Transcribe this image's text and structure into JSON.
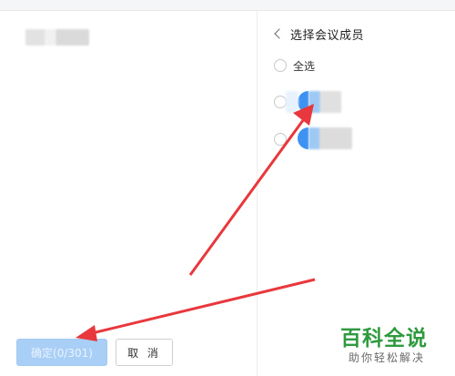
{
  "panel": {
    "title": "选择会议成员",
    "select_all_label": "全选"
  },
  "members": [
    {
      "name": "",
      "selected": false
    },
    {
      "name": "",
      "selected": false
    }
  ],
  "footer": {
    "confirm_label": "确定(0/301)",
    "cancel_label": "取 消"
  },
  "watermark": {
    "main": "百科全说",
    "sub": "助你轻松解决"
  },
  "colors": {
    "accent": "#3d92f2",
    "confirm_disabled": "#a9cff6",
    "annotation_arrow": "#e8383d",
    "watermark_green": "#2f9a3f"
  },
  "icons": {
    "back": "chevron-left-icon",
    "avatar": "avatar"
  }
}
